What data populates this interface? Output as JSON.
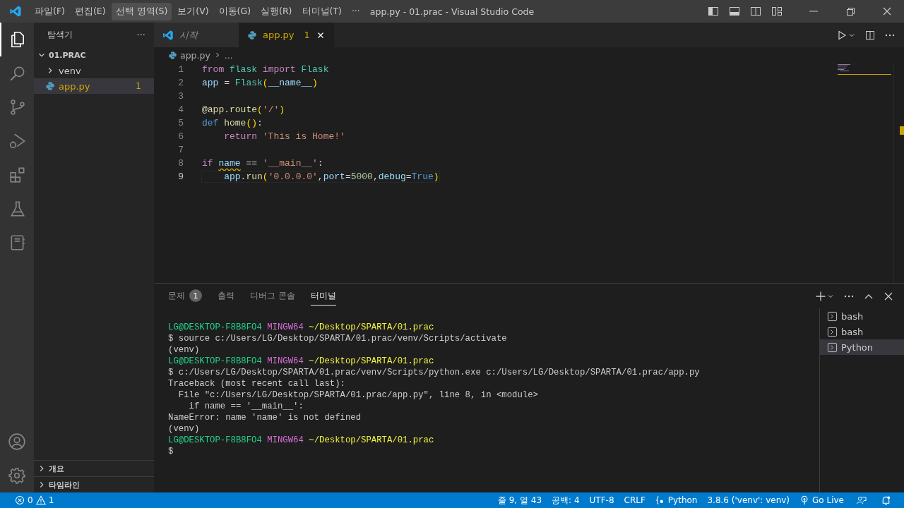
{
  "window": {
    "title": "app.py - 01.prac - Visual Studio Code"
  },
  "menu": [
    {
      "label": "파일(F)",
      "hovered": false
    },
    {
      "label": "편집(E)",
      "hovered": false
    },
    {
      "label": "선택 영역(S)",
      "hovered": true
    },
    {
      "label": "보기(V)",
      "hovered": false
    },
    {
      "label": "이동(G)",
      "hovered": false
    },
    {
      "label": "실행(R)",
      "hovered": false
    },
    {
      "label": "터미널(T)",
      "hovered": false
    },
    {
      "label": "···",
      "hovered": false
    }
  ],
  "activity_bar": [
    {
      "kind": "files",
      "selected": true
    },
    {
      "kind": "search",
      "selected": false
    },
    {
      "kind": "scm",
      "selected": false
    },
    {
      "kind": "debug",
      "selected": false
    },
    {
      "kind": "extensions",
      "selected": false
    },
    {
      "kind": "testing",
      "selected": false
    },
    {
      "kind": "notebook",
      "selected": false
    }
  ],
  "sidebar": {
    "title": "탐색기",
    "more": "···",
    "folder": {
      "label": "01.PRAC",
      "expanded": true,
      "children": [
        {
          "label": "venv",
          "kind": "folder",
          "expanded": false,
          "selected": false
        },
        {
          "label": "app.py",
          "kind": "python",
          "selected": true,
          "badge": "1"
        }
      ]
    },
    "sections": [
      {
        "label": "개요",
        "expanded": false
      },
      {
        "label": "타임라인",
        "expanded": false
      }
    ]
  },
  "tabs": [
    {
      "label": "시작",
      "kind": "welcome",
      "selected": false
    },
    {
      "label": "app.py",
      "kind": "python",
      "selected": true,
      "badge": "1"
    }
  ],
  "breadcrumb": {
    "file": "app.py",
    "rest": "..."
  },
  "code": [
    {
      "number": "1",
      "current": false,
      "tokens": [
        {
          "text": "from",
          "kind": "kw"
        },
        {
          "text": " flask",
          "kind": "cls"
        },
        {
          "text": " import",
          "kind": "kw"
        },
        {
          "text": " Flask",
          "kind": "cls"
        }
      ]
    },
    {
      "number": "2",
      "current": false,
      "tokens": [
        {
          "text": "app",
          "kind": "var"
        },
        {
          "text": " = "
        },
        {
          "text": "Flask",
          "kind": "cls"
        },
        {
          "text": "(",
          "kind": "br"
        },
        {
          "text": "__name__",
          "kind": "var"
        },
        {
          "text": ")",
          "kind": "br"
        }
      ]
    },
    {
      "number": "3",
      "current": false
    },
    {
      "number": "4",
      "current": false,
      "tokens": [
        {
          "text": "@app.route",
          "kind": "fn"
        },
        {
          "text": "(",
          "kind": "br"
        },
        {
          "text": "'/'",
          "kind": "str"
        },
        {
          "text": ")",
          "kind": "br"
        }
      ]
    },
    {
      "number": "5",
      "current": false,
      "tokens": [
        {
          "text": "def",
          "kind": "def"
        },
        {
          "text": " home",
          "kind": "fn"
        },
        {
          "text": "()",
          "kind": "br"
        },
        {
          "text": ":"
        }
      ]
    },
    {
      "number": "6",
      "current": false,
      "tokens": [
        {
          "text": "    return",
          "kind": "kw"
        },
        {
          "text": " 'This is Home!'",
          "kind": "str"
        }
      ]
    },
    {
      "number": "7",
      "current": false
    },
    {
      "number": "8",
      "current": false,
      "tokens": [
        {
          "text": "if ",
          "kind": "kw"
        },
        {
          "text": "name",
          "kind": "warn"
        },
        {
          "text": " == "
        },
        {
          "text": "'__main__'",
          "kind": "str"
        },
        {
          "text": ":"
        }
      ]
    },
    {
      "number": "9",
      "current": true,
      "tokens": [
        {
          "text": "    app",
          "kind": "var"
        },
        {
          "text": "."
        },
        {
          "text": "run",
          "kind": "fn"
        },
        {
          "text": "(",
          "kind": "br"
        },
        {
          "text": "'0.0.0.0'",
          "kind": "str"
        },
        {
          "text": ","
        },
        {
          "text": "port",
          "kind": "var"
        },
        {
          "text": "="
        },
        {
          "text": "5000",
          "kind": "num"
        },
        {
          "text": ","
        },
        {
          "text": "debug",
          "kind": "var"
        },
        {
          "text": "="
        },
        {
          "text": "True",
          "kind": "def"
        },
        {
          "text": ")",
          "kind": "br"
        }
      ]
    }
  ],
  "panel": {
    "tabs": [
      {
        "label": "문제",
        "selected": false,
        "badge": "1"
      },
      {
        "label": "출력",
        "selected": false
      },
      {
        "label": "디버그 콘솔",
        "selected": false
      },
      {
        "label": "터미널",
        "selected": true
      }
    ],
    "terminal": [
      [
        {
          "text": "LG@DESKTOP-F8B8FO4",
          "kind": "user"
        },
        {
          "text": " MINGW64",
          "kind": "host"
        },
        {
          "text": " ~/Desktop/SPARTA/01.prac",
          "kind": "path"
        }
      ],
      [
        {
          "text": "$ source c:/Users/LG/Desktop/SPARTA/01.prac/venv/Scripts/activate"
        }
      ],
      [
        {
          "text": "(venv)"
        }
      ],
      [
        {
          "text": "LG@DESKTOP-F8B8FO4",
          "kind": "user"
        },
        {
          "text": " MINGW64",
          "kind": "host"
        },
        {
          "text": " ~/Desktop/SPARTA/01.prac",
          "kind": "path"
        }
      ],
      [
        {
          "text": "$ c:/Users/LG/Desktop/SPARTA/01.prac/venv/Scripts/python.exe c:/Users/LG/Desktop/SPARTA/01.prac/app.py"
        }
      ],
      [
        {
          "text": "Traceback (most recent call last):"
        }
      ],
      [
        {
          "text": "  File \"c:/Users/LG/Desktop/SPARTA/01.prac/app.py\", line 8, in <module>"
        }
      ],
      [
        {
          "text": "    if name == '__main__':"
        }
      ],
      [
        {
          "text": "NameError: name 'name' is not defined"
        }
      ],
      [
        {
          "text": "(venv)"
        }
      ],
      [
        {
          "text": "LG@DESKTOP-F8B8FO4",
          "kind": "user"
        },
        {
          "text": " MINGW64",
          "kind": "host"
        },
        {
          "text": " ~/Desktop/SPARTA/01.prac",
          "kind": "path"
        }
      ],
      [
        {
          "text": "$"
        }
      ]
    ],
    "shells": [
      {
        "label": "bash",
        "selected": false
      },
      {
        "label": "bash",
        "selected": false
      },
      {
        "label": "Python",
        "selected": true
      }
    ]
  },
  "status_bar": {
    "errors": "0",
    "warnings": "1",
    "right": [
      {
        "label": "줄 9, 열 43",
        "kind": "text"
      },
      {
        "label": "공백: 4",
        "kind": "text"
      },
      {
        "label": "UTF-8",
        "kind": "text"
      },
      {
        "label": "CRLF",
        "kind": "text"
      },
      {
        "label": "Python",
        "kind": "language"
      },
      {
        "label": "3.8.6 ('venv': venv)",
        "kind": "text"
      },
      {
        "label": "Go Live",
        "kind": "live"
      }
    ]
  }
}
